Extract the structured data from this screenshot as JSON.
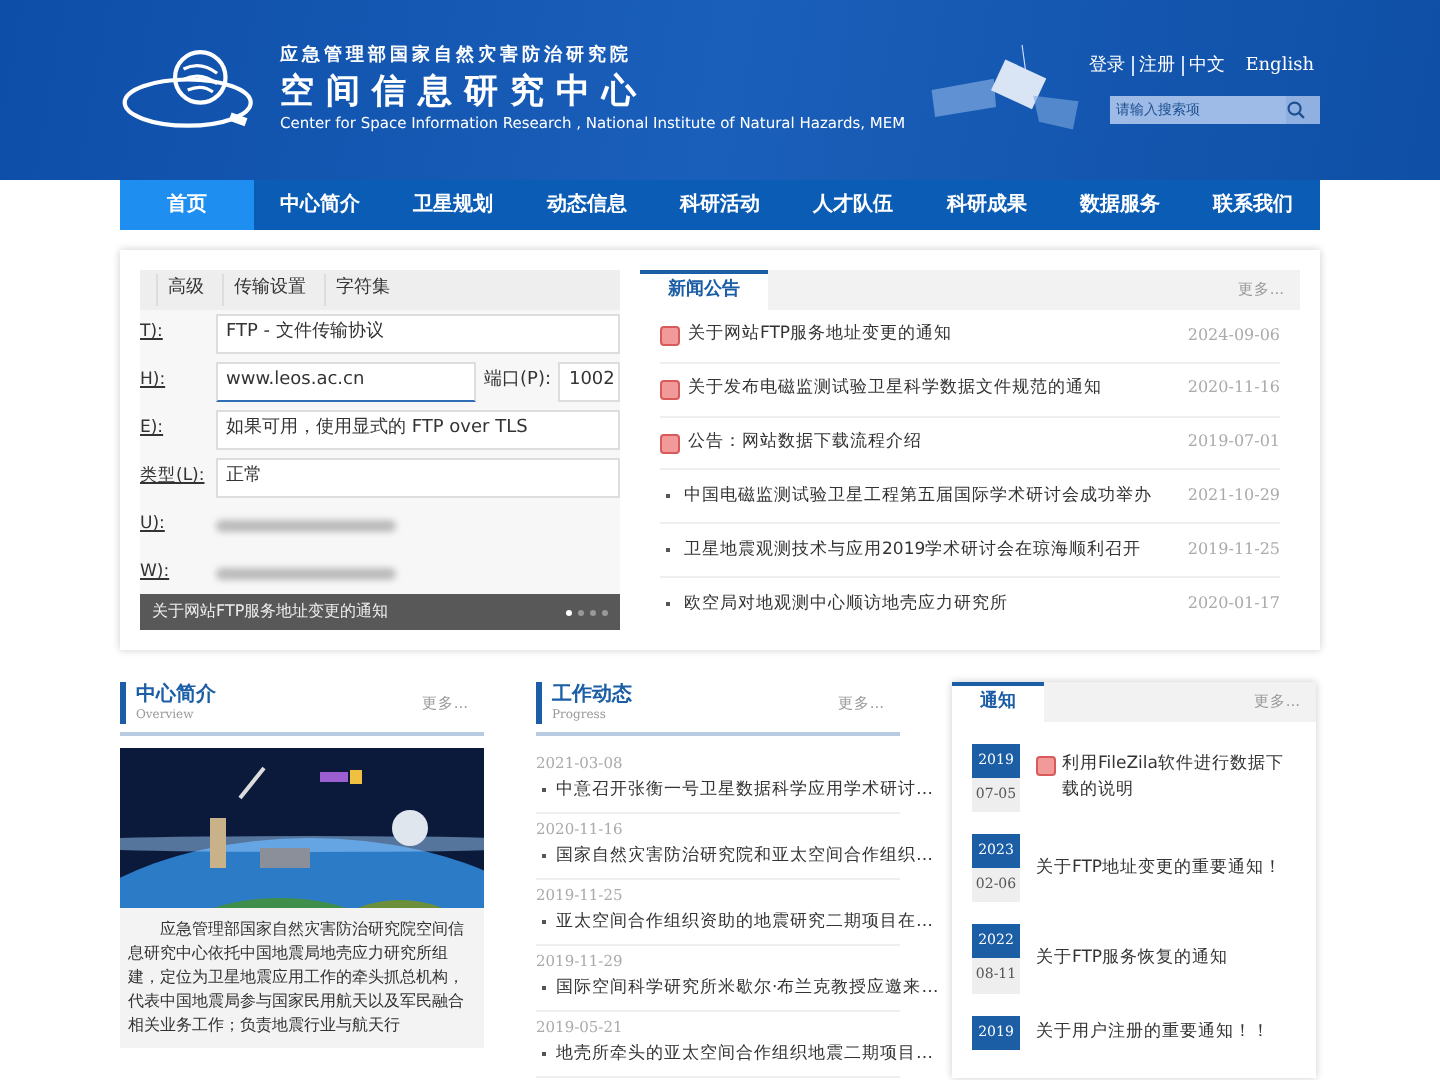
{
  "header": {
    "org": "应急管理部国家自然灾害防治研究院",
    "title": "空间信息研究中心",
    "subtitle": "Center for Space Information Research , National Institute of Natural Hazards, MEM",
    "links": [
      "登录",
      "注册",
      "中文",
      "English"
    ],
    "search": {
      "placeholder": "请输入搜索项"
    }
  },
  "nav": [
    {
      "label": "首页",
      "selected": true
    },
    {
      "label": "中心简介",
      "selected": false
    },
    {
      "label": "卫星规划",
      "selected": false
    },
    {
      "label": "动态信息",
      "selected": false
    },
    {
      "label": "科研活动",
      "selected": false
    },
    {
      "label": "人才队伍",
      "selected": false
    },
    {
      "label": "科研成果",
      "selected": false
    },
    {
      "label": "数据服务",
      "selected": false
    },
    {
      "label": "联系我们",
      "selected": false
    }
  ],
  "slide": {
    "tabs": [
      "高级",
      "传输设置",
      "字符集"
    ],
    "fields": [
      {
        "label": "T):",
        "value": "FTP - 文件传输协议",
        "kind": "text"
      },
      {
        "label": "H):",
        "value": "www.leos.ac.cn",
        "kind": "text",
        "extra_label": "端口(P):",
        "extra_value": "1002"
      },
      {
        "label": "E):",
        "value": "如果可用，使用显式的 FTP over TLS",
        "kind": "text"
      },
      {
        "label": "类型(L):",
        "value": "正常",
        "kind": "text"
      },
      {
        "label": "U):",
        "kind": "blurred"
      },
      {
        "label": "W):",
        "kind": "blurred"
      }
    ],
    "caption": "关于网站FTP服务地址变更的通知",
    "dots": [
      {
        "selected": true
      },
      {
        "selected": false
      },
      {
        "selected": false
      },
      {
        "selected": false
      }
    ]
  },
  "news": {
    "tab": "新闻公告",
    "more": "更多...",
    "items": [
      {
        "title": "关于网站FTP服务地址变更的通知",
        "date": "2024-09-06",
        "badge": true
      },
      {
        "title": "关于发布电磁监测试验卫星科学数据文件规范的通知",
        "date": "2020-11-16",
        "badge": true
      },
      {
        "title": "公告：网站数据下载流程介绍",
        "date": "2019-07-01",
        "badge": true
      },
      {
        "title": "中国电磁监测试验卫星工程第五届国际学术研讨会成功举办",
        "date": "2021-10-29",
        "badge": false
      },
      {
        "title": "卫星地震观测技术与应用2019学术研讨会在琼海顺利召开",
        "date": "2019-11-25",
        "badge": false
      },
      {
        "title": "欧空局对地观测中心顺访地壳应力研究所",
        "date": "2020-01-17",
        "badge": false
      }
    ]
  },
  "overview": {
    "title": "中心简介",
    "subtitle": "Overview",
    "more": "更多...",
    "text": "应急管理部国家自然灾害防治研究院空间信息研究中心依托中国地震局地壳应力研究所组建，定位为卫星地震应用工作的牵头抓总机构，代表中国地震局参与国家民用航天以及军民融合相关业务工作；负责地震行业与航天行"
  },
  "progress": {
    "title": "工作动态",
    "subtitle": "Progress",
    "more": "更多...",
    "items": [
      {
        "date": "2021-03-08",
        "title": "中意召开张衡一号卫星数据科学应用学术研讨…"
      },
      {
        "date": "2020-11-16",
        "title": "国家自然灾害防治研究院和亚太空间合作组织…"
      },
      {
        "date": "2019-11-25",
        "title": "亚太空间合作组织资助的地震研究二期项目在…"
      },
      {
        "date": "2019-11-29",
        "title": "国际空间科学研究所米歇尔·布兰克教授应邀来…"
      },
      {
        "date": "2019-05-21",
        "title": "地壳所牵头的亚太空间合作组织地震二期项目…"
      }
    ]
  },
  "notices": {
    "tab": "通知",
    "more": "更多...",
    "items": [
      {
        "year": "2019",
        "md": "07-05",
        "title": "利用FileZila软件进行数据下载的说明",
        "badge": true
      },
      {
        "year": "2023",
        "md": "02-06",
        "title": "关于FTP地址变更的重要通知！",
        "badge": false
      },
      {
        "year": "2022",
        "md": "08-11",
        "title": "关于FTP服务恢复的通知",
        "badge": false
      },
      {
        "year": "2019",
        "title": "关于用户注册的重要通知！！",
        "badge": false
      }
    ]
  }
}
